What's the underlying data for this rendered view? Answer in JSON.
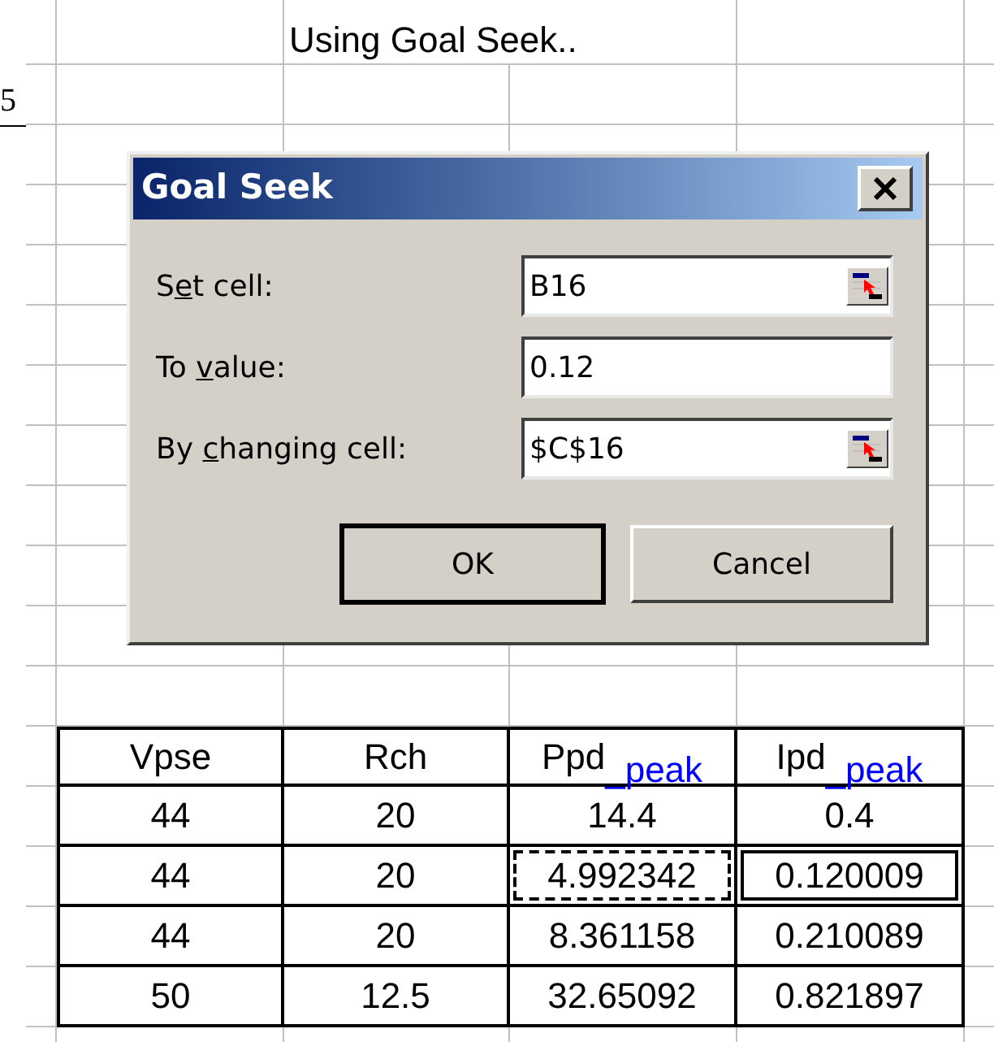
{
  "sheet": {
    "title": "Using Goal Seek..",
    "edge_fragment": "5"
  },
  "dialog": {
    "title": "Goal Seek",
    "fields": [
      {
        "label_start": "S",
        "mnemonic": "e",
        "label_end": "t cell:",
        "value": "B16",
        "picker": true
      },
      {
        "label_start": "To ",
        "mnemonic": "v",
        "label_end": "alue:",
        "value": "0.12",
        "picker": false
      },
      {
        "label_start": "By ",
        "mnemonic": "c",
        "label_end": "hanging cell:",
        "value": "$C$16",
        "picker": true
      }
    ],
    "buttons": [
      {
        "label": "OK",
        "default": true
      },
      {
        "label": "Cancel",
        "default": false
      }
    ]
  },
  "table": {
    "columns": [
      "Vpse",
      "Rch",
      "Ppd$_{_peak}$",
      "Ipd$_{_peak}$"
    ],
    "rows": [
      {
        "cells": [
          {
            "text": "44",
            "selected": false,
            "copied": false
          },
          {
            "text": "20",
            "selected": false,
            "copied": false
          },
          {
            "text": "14.4",
            "selected": false,
            "copied": false
          },
          {
            "text": "0.4",
            "selected": false,
            "copied": false
          }
        ]
      },
      {
        "cells": [
          {
            "text": "44",
            "selected": false,
            "copied": false
          },
          {
            "text": "20",
            "selected": false,
            "copied": false
          },
          {
            "text": "4.992342",
            "selected": false,
            "copied": true
          },
          {
            "text": "0.120009",
            "selected": true,
            "copied": false
          }
        ]
      },
      {
        "cells": [
          {
            "text": "44",
            "selected": false,
            "copied": false
          },
          {
            "text": "20",
            "selected": false,
            "copied": false
          },
          {
            "text": "8.361158",
            "selected": false,
            "copied": false
          },
          {
            "text": "0.210089",
            "selected": false,
            "copied": false
          }
        ]
      },
      {
        "cells": [
          {
            "text": "50",
            "selected": false,
            "copied": false
          },
          {
            "text": "12.5",
            "selected": false,
            "copied": false
          },
          {
            "text": "32.65092",
            "selected": false,
            "copied": false
          },
          {
            "text": "0.821897",
            "selected": false,
            "copied": false
          }
        ]
      }
    ]
  }
}
